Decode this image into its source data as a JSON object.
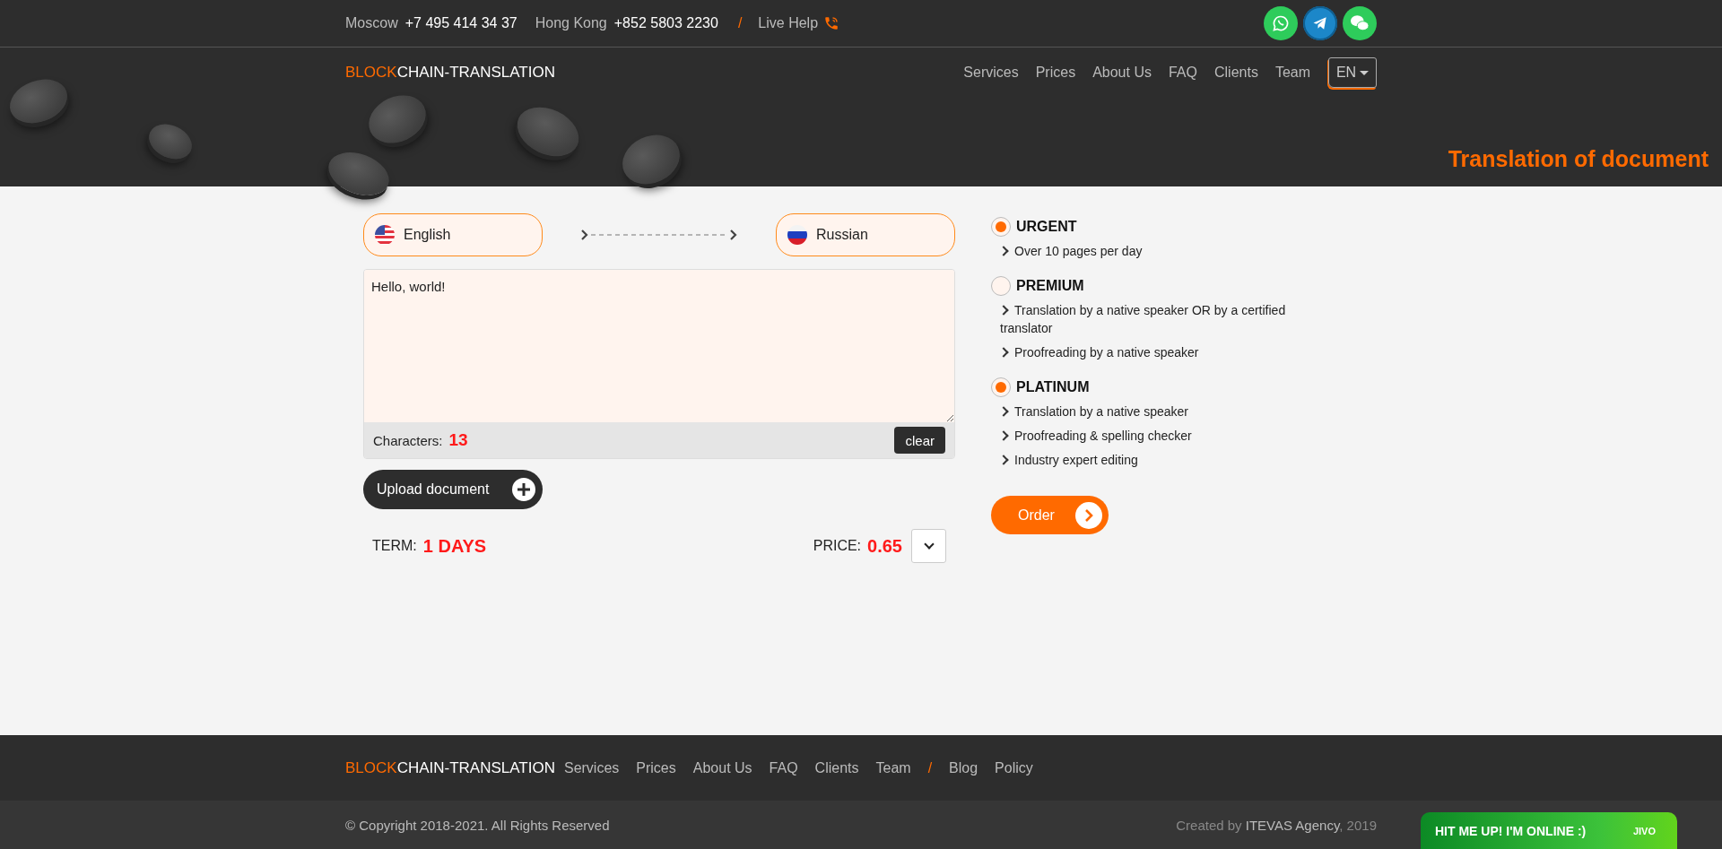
{
  "top_bar": {
    "contacts": [
      {
        "city": "Moscow",
        "phone": "+7 495 414 34 37"
      },
      {
        "city": "Hong Kong",
        "phone": "+852 5803 2230"
      }
    ],
    "separator": "/",
    "live_help": "Live Help"
  },
  "logo": {
    "accent": "BLOCK",
    "rest": "CHAIN-TRANSLATION"
  },
  "nav": [
    "Services",
    "Prices",
    "About Us",
    "FAQ",
    "Clients",
    "Team"
  ],
  "language_menu": "EN",
  "page_title": "Translation of document",
  "languages": {
    "source": "English",
    "target": "Russian"
  },
  "text_input": {
    "value": "Hello, world!",
    "characters_label": "Characters:",
    "characters_count": "13",
    "clear_button": "clear"
  },
  "upload_button": "Upload document",
  "term": {
    "label": "TERM:",
    "value": "1 DAYS"
  },
  "price": {
    "label": "PRICE:",
    "value": "0.65"
  },
  "options": [
    {
      "title": "URGENT",
      "checked": true,
      "features": [
        "Over 10 pages per day"
      ]
    },
    {
      "title": "PREMIUM",
      "checked": false,
      "features": [
        "Translation by a native speaker OR by a certified translator",
        "Proofreading by a native speaker"
      ]
    },
    {
      "title": "PLATINUM",
      "checked": true,
      "features": [
        "Translation by a native speaker",
        "Proofreading & spelling checker",
        "Industry expert editing"
      ]
    }
  ],
  "order_button": "Order",
  "footer": {
    "logo": {
      "accent": "BLOCK",
      "rest": "CHAIN-TRANSLATION"
    },
    "nav": [
      "Services",
      "Prices",
      "About Us",
      "FAQ",
      "Clients",
      "Team"
    ],
    "separator": "/",
    "extra_links": [
      "Blog",
      "Policy"
    ],
    "copyright": "© Copyright 2018-2021. All Rights Reserved",
    "credit_prefix": "Created by",
    "credit_link": "ITEVAS Agency",
    "credit_suffix": ", 2019"
  },
  "chat_widget": {
    "text": "HIT ME UP! I'M ONLINE :)",
    "brand": "JIVO"
  }
}
